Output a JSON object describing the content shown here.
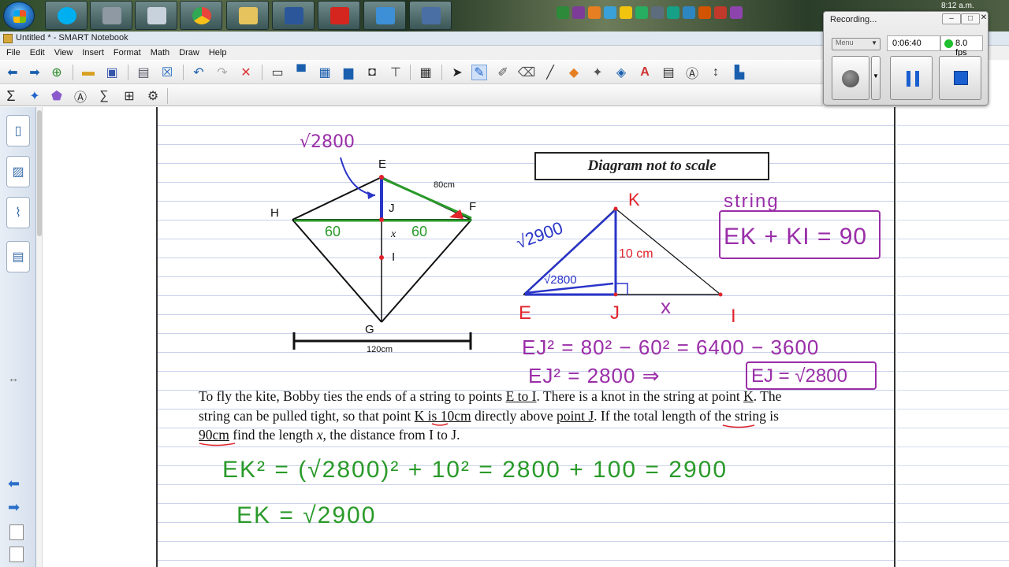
{
  "taskbar": {
    "apps": [
      {
        "name": "skype",
        "color": "#00aff0"
      },
      {
        "name": "calculator",
        "color": "#9aa6b2"
      },
      {
        "name": "calculator-2",
        "color": "#c8d2dc"
      },
      {
        "name": "chrome",
        "color": "#e8453c"
      },
      {
        "name": "explorer",
        "color": "#e6c35c"
      },
      {
        "name": "word",
        "color": "#2b579a"
      },
      {
        "name": "acrobat",
        "color": "#d4251f"
      },
      {
        "name": "notebook",
        "color": "#3d8fd6"
      },
      {
        "name": "recorder",
        "color": "#4a6fa5"
      }
    ],
    "clock": "8:12 a.m."
  },
  "window": {
    "title": "Untitled * - SMART Notebook"
  },
  "menu": [
    "File",
    "Edit",
    "View",
    "Insert",
    "Format",
    "Math",
    "Draw",
    "Help"
  ],
  "toolbar": {
    "row1": [
      "back-icon",
      "forward-icon",
      "add-page-icon",
      "open-icon",
      "save-icon",
      "paste-icon",
      "delete-icon",
      "undo-icon",
      "redo-icon",
      "cancel-icon",
      "screen-shade-icon",
      "display-icon",
      "capture-icon",
      "camera-icon",
      "document-camera-icon",
      "table-icon",
      "select-icon",
      "pen-icon",
      "creative-pen-icon",
      "eraser-icon",
      "line-icon",
      "shape-icon",
      "magic-pen-icon",
      "fill-icon",
      "text-icon",
      "font-icon",
      "recognize-icon",
      "move-icon",
      "properties-icon"
    ],
    "row2": [
      "sigma-icon",
      "shapes-icon",
      "3d-icon",
      "math-tools-icon",
      "formula-icon",
      "graph-icon",
      "settings-icon"
    ]
  },
  "diagram": {
    "labels": {
      "E": "E",
      "F": "F",
      "H": "H",
      "J": "J",
      "I": "I",
      "G": "G",
      "x": "x",
      "ef_length": "80cm",
      "hf_width": "120cm",
      "sqrt2800": "√2800",
      "sixty_left": "60",
      "sixty_right": "60"
    }
  },
  "diagram_note": "Diagram not to scale",
  "handwriting": {
    "K": "K",
    "E": "E",
    "J": "J",
    "I": "I",
    "x": "x",
    "ten_cm": "10 cm",
    "sqrt2900": "√2900",
    "sqrt2800_small": "√2800",
    "string": "string",
    "ek_ki": "EK + KI = 90",
    "ej_sq_line": "EJ² = 80² − 60² = 6400 − 3600",
    "ej_sq2": "EJ² = 2800 ⇒",
    "ej_result": "EJ = √2800",
    "ek_sq": "EK² = (√2800)² + 10² = 2800 + 100 = 2900",
    "ek_result": "EK = √2900"
  },
  "problem": {
    "text1": "To fly the kite, Bobby ties the ends of a string to points ",
    "u1": "E to I",
    "text2": ". There is a knot in the string at point ",
    "u2": "K",
    "text3": ". The string can be pulled tight, so that point ",
    "u3": "K is 10cm",
    "text4": " directly above ",
    "u4": "point J",
    "text5": ". If the total length of the string is ",
    "u5": "90cm",
    "text6": " find the length ",
    "var": "x",
    "text7": ", the distance from I to J."
  },
  "recorder": {
    "title": "Recording...",
    "menu_label": "Menu",
    "time": "0:06:40",
    "fps": "8.0 fps",
    "minimize": "–",
    "restore": "□",
    "close": "✕"
  },
  "colors": {
    "green_ink": "#2a9a2a",
    "red_ink": "#e0242b",
    "purple_ink": "#9a2ea8",
    "blue_ink": "#2a35c8"
  }
}
